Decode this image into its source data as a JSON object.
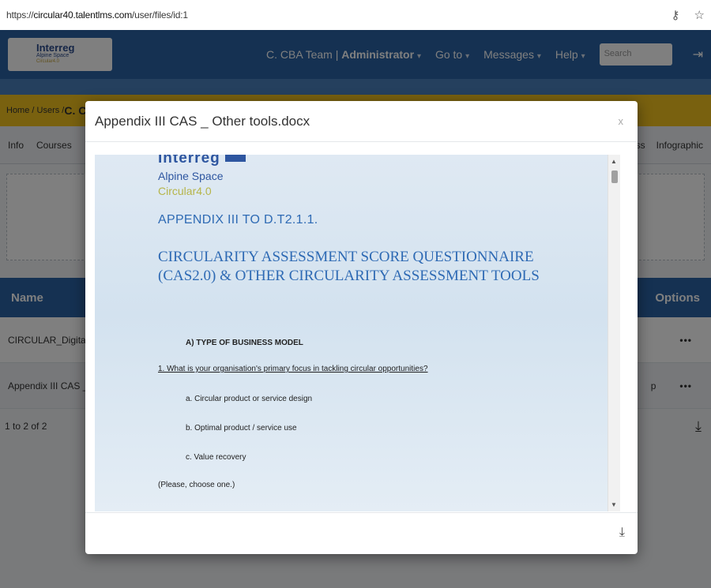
{
  "browser": {
    "url_prefix": "https://",
    "url_host": "circular40.talentlms.com",
    "url_path": "/user/files/id:1"
  },
  "topnav": {
    "logo_line1": "Interreg",
    "logo_line2": "Alpine Space",
    "logo_line3": "Circular4.0",
    "user_label": "C. CBA Team | ",
    "role_label": "Administrator",
    "goto_label": "Go to",
    "messages_label": "Messages",
    "help_label": "Help",
    "search_placeholder": "Search"
  },
  "breadcrumb": {
    "path": "Home / Users / ",
    "current": "C. CB"
  },
  "tabs": {
    "left": [
      "Info",
      "Courses"
    ],
    "right": [
      "ress",
      "Infographic"
    ]
  },
  "table": {
    "headers": {
      "name": "Name",
      "options": "Options"
    },
    "rows": [
      {
        "name": "CIRCULAR_Digital_M",
        "extra": "",
        "options": "•••"
      },
      {
        "name": "Appendix III CAS _ O",
        "extra": "p",
        "options": "•••"
      }
    ],
    "pager": "1 to 2 of 2"
  },
  "modal": {
    "title": "Appendix III CAS _ Other tools.docx",
    "close": "x"
  },
  "document": {
    "logo_line1": "Interreg",
    "logo_line2": "Alpine Space",
    "logo_line3": "Circular4.0",
    "appendix": "APPENDIX III TO D.T2.1.1.",
    "title": "CIRCULARITY ASSESSMENT SCORE QUESTIONNAIRE (CAS2.0) & OTHER CIRCULARITY ASSESSMENT TOOLS",
    "section": "A)  TYPE OF BUSINESS MODEL",
    "question": "1.  What is your organisation's primary focus in tackling circular opportunities?",
    "options": [
      "a.   Circular product or service design",
      "b.   Optimal product / service use",
      "c.   Value recovery"
    ],
    "note": "(Please, choose one.)"
  },
  "icons": {
    "download": "download-tray-icon",
    "lock": "lock-icon",
    "star": "star-icon"
  },
  "colors": {
    "nav_blue": "#2a63a5",
    "breadcrumb_yellow": "#f3c21f",
    "doc_title_blue": "#2e6ab4"
  }
}
